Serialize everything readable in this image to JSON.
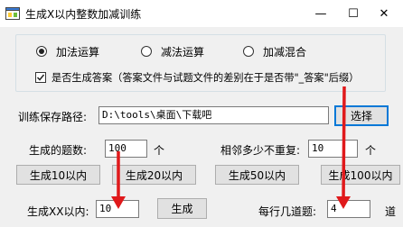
{
  "window": {
    "title": "生成X以内整数加减训练",
    "minimize_glyph": "—",
    "maximize_glyph": "☐",
    "close_glyph": "✕",
    "icon": "app-icon"
  },
  "operation": {
    "options": [
      {
        "label": "加法运算",
        "selected": true
      },
      {
        "label": "减法运算",
        "selected": false
      },
      {
        "label": "加减混合",
        "selected": false
      }
    ],
    "answer_checkbox": {
      "label": "是否生成答案（答案文件与试题文件的差别在于是否带\"_答案\"后缀）",
      "checked": true
    }
  },
  "save_path": {
    "label": "训练保存路径:",
    "value": "D:\\tools\\桌面\\下载吧",
    "browse_label": "选择"
  },
  "count": {
    "label": "生成的题数:",
    "value": "100",
    "unit": "个"
  },
  "no_repeat": {
    "label": "相邻多少不重复:",
    "value": "10",
    "unit": "个"
  },
  "presets": [
    "生成10以内",
    "生成20以内",
    "生成50以内",
    "生成100以内"
  ],
  "custom": {
    "label": "生成XX以内:",
    "value": "10",
    "generate_label": "生成"
  },
  "per_row": {
    "label": "每行几道题:",
    "value": "4",
    "unit": "道"
  },
  "colors": {
    "annotation_arrow": "#e0191b",
    "accent": "#0078d7"
  }
}
